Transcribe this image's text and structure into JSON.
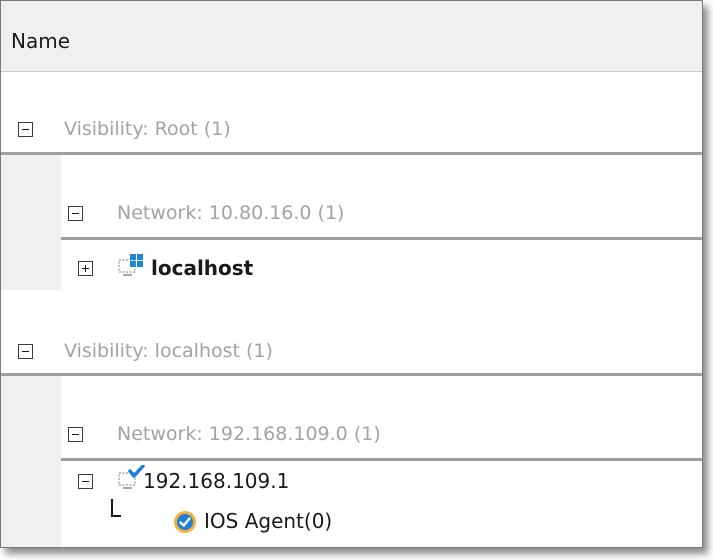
{
  "header": {
    "column_label": "Name"
  },
  "tree": {
    "visibility_root": "Visibility: Root (1)",
    "network_1": "Network: 10.80.16.0 (1)",
    "host_localhost": "localhost",
    "visibility_localhost": "Visibility: localhost (1)",
    "network_2": "Network: 192.168.109.0 (1)",
    "host_192": "192.168.109.1",
    "agent": "IOS Agent(0)"
  },
  "icons": {
    "expand": "plus-box-icon",
    "collapse": "minus-box-icon",
    "windows_computer": "windows-computer-icon",
    "monitored_computer": "monitored-computer-icon",
    "agent": "agent-check-icon"
  },
  "colors": {
    "group_text": "#a3a3a3",
    "header_bg": "#f0f0f0",
    "check_blue": "#1f7fd8",
    "agent_ring": "#f2b13a"
  }
}
